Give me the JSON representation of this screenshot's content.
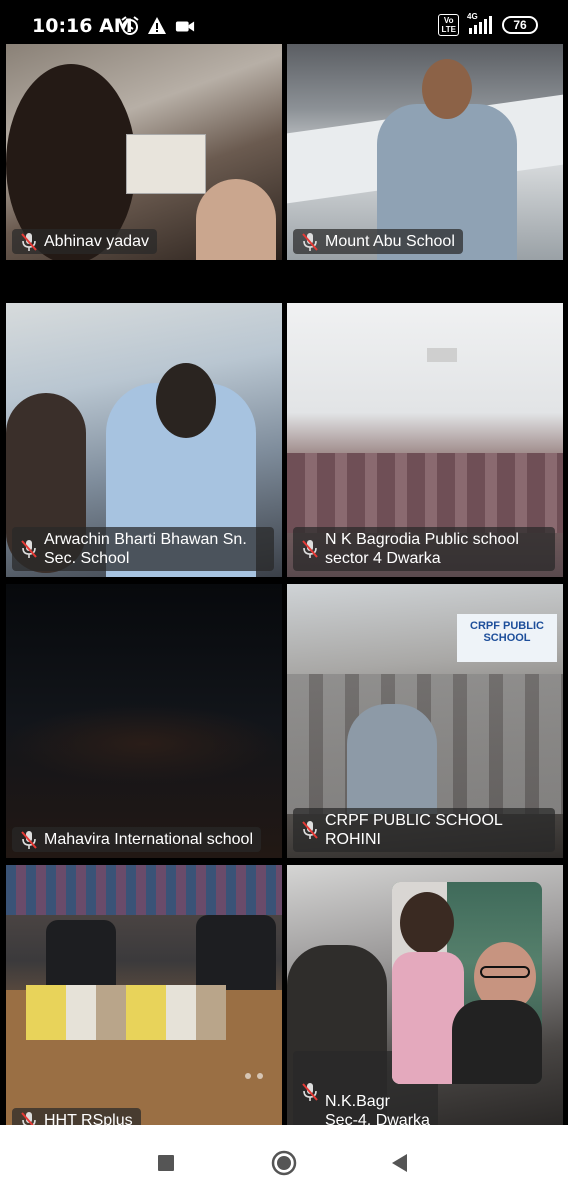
{
  "status_bar": {
    "time": "10:16 AM",
    "icons": [
      "alarm-icon",
      "warning-icon",
      "video-camera-icon"
    ],
    "volte_label": "Vo\nLTE",
    "network_label": "4G",
    "battery": "76"
  },
  "participants": [
    {
      "name": "Abhinav yadav",
      "mic": "muted"
    },
    {
      "name": "Mount Abu School",
      "mic": "muted"
    },
    {
      "name": "Arwachin Bharti Bhawan Sn. Sec. School",
      "mic": "muted"
    },
    {
      "name": "N K Bagrodia Public school sector 4 Dwarka",
      "mic": "muted"
    },
    {
      "name": "Mahavira International school",
      "mic": "muted"
    },
    {
      "name": "CRPF PUBLIC SCHOOL ROHINI",
      "mic": "muted"
    },
    {
      "name": "HHT RSplus",
      "mic": "muted"
    },
    {
      "name": "N.K.Bagr\nSec-4, Dwarka",
      "mic": "muted"
    }
  ],
  "scene_text": {
    "banner": "CRPF PUBLIC SCHOOL"
  },
  "nav_bar": {
    "buttons": [
      "recent-apps-button",
      "home-button",
      "back-button"
    ]
  }
}
